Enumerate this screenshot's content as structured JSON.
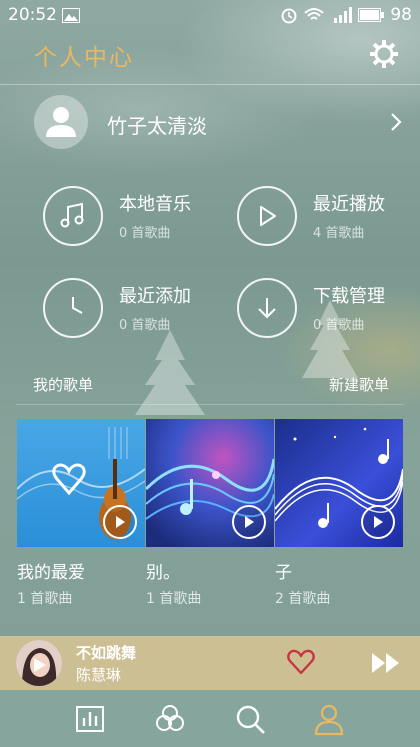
{
  "status": {
    "time": "20:52",
    "battery": "98",
    "network": "4G"
  },
  "header": {
    "title": "个人中心"
  },
  "profile": {
    "name": "竹子太清淡"
  },
  "tiles": [
    {
      "title": "本地音乐",
      "count": "0 首歌曲",
      "icon": "music-note-icon"
    },
    {
      "title": "最近播放",
      "count": "4 首歌曲",
      "icon": "play-icon"
    },
    {
      "title": "最近添加",
      "count": "0 首歌曲",
      "icon": "clock-icon"
    },
    {
      "title": "下载管理",
      "count": "0 首歌曲",
      "icon": "download-icon"
    }
  ],
  "playlists_section": {
    "left": "我的歌单",
    "right": "新建歌单"
  },
  "playlists": [
    {
      "name": "我的最爱",
      "count": "1 首歌曲"
    },
    {
      "name": "别。",
      "count": "1 首歌曲"
    },
    {
      "name": "子",
      "count": "2 首歌曲"
    }
  ],
  "player": {
    "title": "不如跳舞",
    "artist": "陈慧琳"
  },
  "colors": {
    "accent": "#e9b860",
    "heart": "#c8343f",
    "player_bg": "#cdbf94"
  }
}
